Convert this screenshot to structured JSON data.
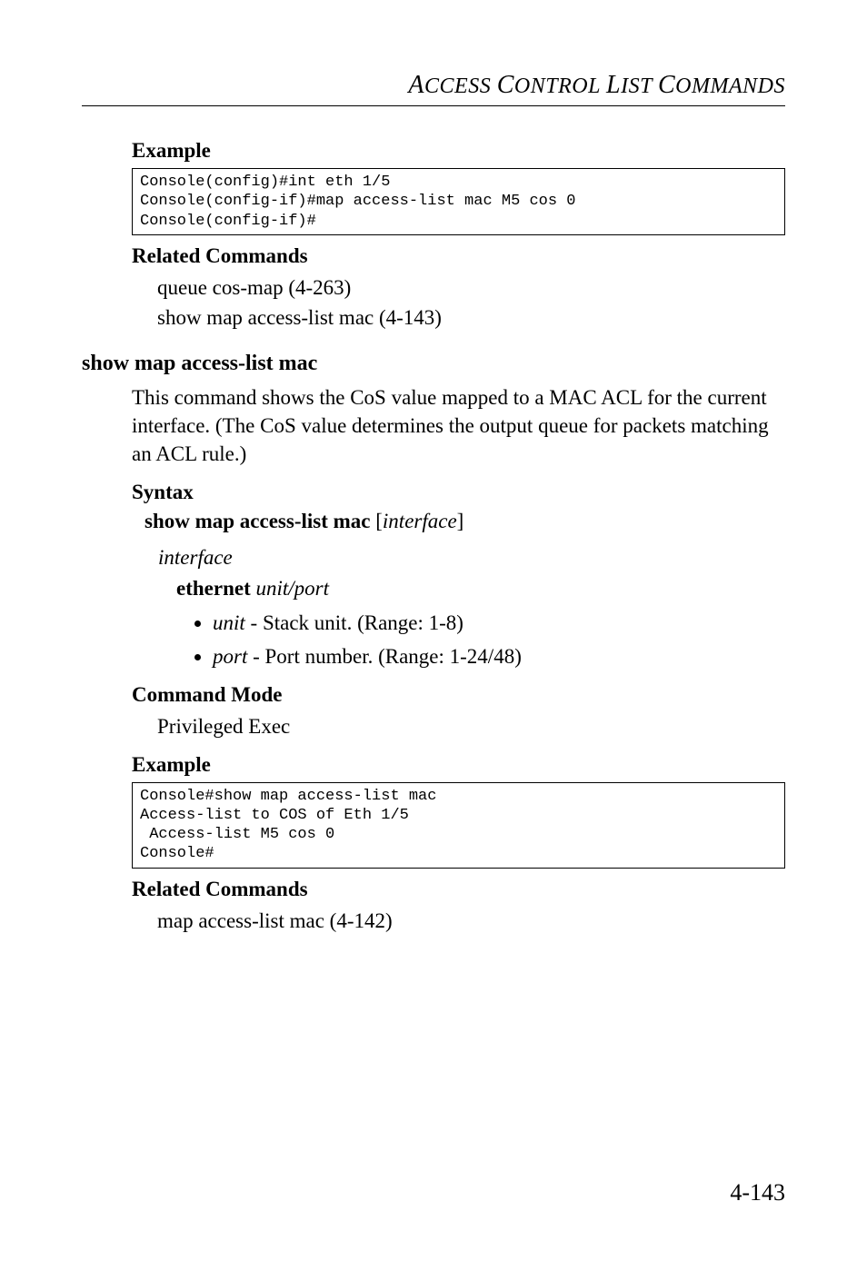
{
  "running_head": "ACCESS CONTROL LIST COMMANDS",
  "sections": {
    "example1": {
      "heading": "Example",
      "code": "Console(config)#int eth 1/5\nConsole(config-if)#map access-list mac M5 cos 0\nConsole(config-if)#"
    },
    "related1": {
      "heading": "Related Commands",
      "lines": [
        "queue cos-map (4-263)",
        "show map access-list mac (4-143)"
      ]
    },
    "cmd": {
      "name": "show map access-list mac",
      "desc": "This command shows the CoS value mapped to a MAC ACL for the current interface. (The CoS value determines the output queue for packets matching an ACL rule.)"
    },
    "syntax": {
      "heading": "Syntax",
      "bold": "show map access-list mac",
      "bracket_open": " [",
      "ital": "interface",
      "bracket_close": "]",
      "param_word": "interface",
      "eth_bold": "ethernet",
      "eth_ital": " unit/port",
      "bullets": [
        {
          "ital": "unit",
          "rest": " - Stack unit. (Range: 1-8)"
        },
        {
          "ital": "port",
          "rest": " - Port number. (Range: 1-24/48)"
        }
      ]
    },
    "cmdmode": {
      "heading": "Command Mode",
      "value": "Privileged Exec"
    },
    "example2": {
      "heading": "Example",
      "code": "Console#show map access-list mac\nAccess-list to COS of Eth 1/5\n Access-list M5 cos 0\nConsole#"
    },
    "related2": {
      "heading": "Related Commands",
      "lines": [
        "map access-list mac (4-142)"
      ]
    }
  },
  "page_number": "4-143"
}
